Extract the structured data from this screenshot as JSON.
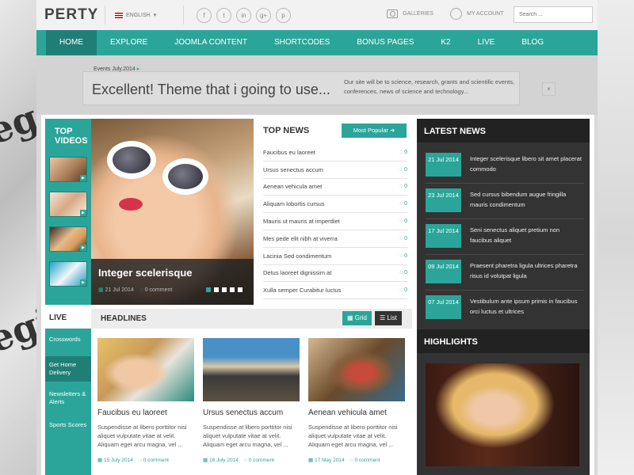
{
  "header": {
    "logo": "PERTY",
    "language": "ENGLISH",
    "social": [
      "f",
      "t",
      "in",
      "g+",
      "p"
    ],
    "galleries": "GALLERIES",
    "account": "MY ACCOUNT",
    "search_placeholder": "Search ..."
  },
  "nav": [
    "HOME",
    "EXPLORE",
    "JOOMLA CONTENT",
    "SHORTCODES",
    "BONUS PAGES",
    "K2",
    "LIVE",
    "BLOG"
  ],
  "banner": {
    "label": "Events July.2014",
    "headline": "Excellent! Theme that i going to use...",
    "description": "Our site will be to science, research, grants and scientific events, conferences, news of science and technology...",
    "close": "×"
  },
  "top_videos": {
    "title": "TOP VIDEOS"
  },
  "hero": {
    "title": "Integer scelerisque",
    "date": "21 Jul 2014",
    "comments": "0 comment"
  },
  "top_news": {
    "title": "TOP NEWS",
    "button": "Most Popular",
    "items": [
      {
        "title": "Faucibus eu laoreet",
        "count": "0"
      },
      {
        "title": "Ursus senectus accum",
        "count": "0"
      },
      {
        "title": "Aenean vehicula amet",
        "count": "0"
      },
      {
        "title": "Aliquam lobortis cursus",
        "count": "0"
      },
      {
        "title": "Mauris ut mauris at imperdiet",
        "count": "0"
      },
      {
        "title": "Mes pede elit nibh at viverra",
        "count": "0"
      },
      {
        "title": "Lacinia Sed condimentum",
        "count": "0"
      },
      {
        "title": "Detus laoreet dignissim at",
        "count": "0"
      },
      {
        "title": "Xulla semper Curabitur luctus",
        "count": "0"
      }
    ]
  },
  "latest_news": {
    "title": "LATEST NEWS",
    "items": [
      {
        "date": "21 Jul 2014",
        "text": "Integer scelerisque libero sit amet placerat commodo"
      },
      {
        "date": "23 Jul 2014",
        "text": "Sed cursus bibendum augue fringilla mauris condimentum"
      },
      {
        "date": "17 Jul 2014",
        "text": "Seni senectus aliquet pretium non faucibus aliquet"
      },
      {
        "date": "09 Jul 2014",
        "text": "Praesent pharetra ligula ultrices pharetra risus id volutpat ligula"
      },
      {
        "date": "07 Jul 2014",
        "text": "Vestibulum ante ipsum primis in faucibus orci luctus et ultrices"
      }
    ]
  },
  "highlights": {
    "title": "HIGHLIGHTS"
  },
  "live": {
    "title": "LIVE",
    "items": [
      "Crosswords",
      "Get Home Delivery",
      "Newsletters & Alerts",
      "Sports Scores"
    ]
  },
  "headlines": {
    "title": "HEADLINES",
    "grid": "Grid",
    "list": "List",
    "cards": [
      {
        "title": "Faucibus eu laoreet",
        "text": "Suspendisse at libero porttitor nisi aliquet vulputate vitae at velit. Aliquam eget arcu magna, vel ...",
        "date": "15 July 2014",
        "comments": "0 comment"
      },
      {
        "title": "Ursus senectus accum",
        "text": "Suspendisse at libero porttitor nisi aliquet vulputate vitae at velit. Aliquam eget arcu magna, vel ...",
        "date": "16 July 2014",
        "comments": "0 comment"
      },
      {
        "title": "Aenean vehicula amet",
        "text": "Suspendisse at libero porttitor nisi aliquet vulputate vitae at velit. Aliquam eget arcu magna, vel ...",
        "date": "17 May 2014",
        "comments": "0 comment"
      }
    ]
  },
  "colors": {
    "accent": "#2ba59a",
    "accent_dark": "#1f7f77",
    "dark_panel": "#333333"
  }
}
